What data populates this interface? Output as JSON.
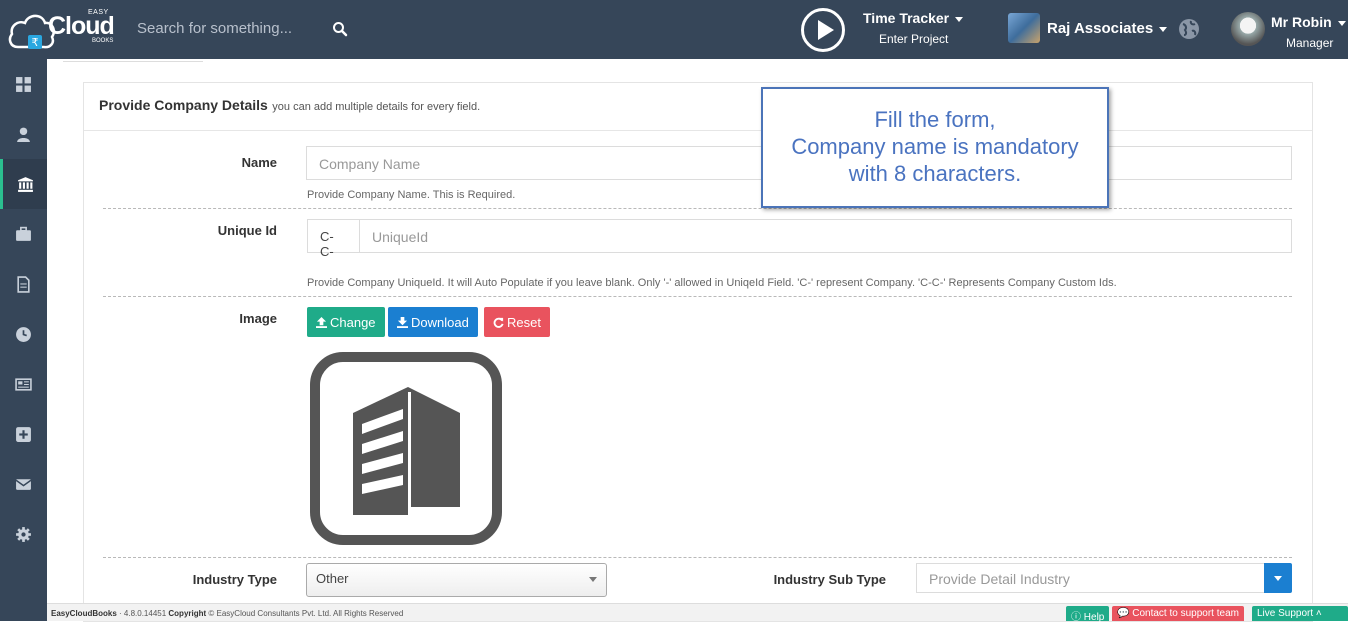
{
  "brand": {
    "easy": "EASY",
    "cloud": "Cloud",
    "books": "BOOKS"
  },
  "search": {
    "placeholder": "Search for something..."
  },
  "time_tracker": {
    "title": "Time Tracker",
    "subtitle": "Enter Project"
  },
  "organization": {
    "name": "Raj Associates"
  },
  "user": {
    "name": "Mr Robin",
    "role": "Manager"
  },
  "sidebar": {
    "items": [
      {
        "icon": "dashboard-icon",
        "active": false
      },
      {
        "icon": "user-icon",
        "active": false
      },
      {
        "icon": "bank-icon",
        "active": true
      },
      {
        "icon": "briefcase-icon",
        "active": false
      },
      {
        "icon": "document-icon",
        "active": false
      },
      {
        "icon": "clock-icon",
        "active": false
      },
      {
        "icon": "newspaper-icon",
        "active": false
      },
      {
        "icon": "plus-square-icon",
        "active": false
      },
      {
        "icon": "envelope-icon",
        "active": false
      },
      {
        "icon": "gear-icon",
        "active": false
      }
    ]
  },
  "panel": {
    "title": "Provide Company Details",
    "subtitle": "you can add multiple details for every field."
  },
  "form": {
    "name": {
      "label": "Name",
      "placeholder": "Company Name",
      "help": "Provide Company Name. This is Required."
    },
    "unique_id": {
      "label": "Unique Id",
      "prefix": "C-C-",
      "placeholder": "UniqueId",
      "help": "Provide Company UniqueId. It will Auto Populate if you leave blank. Only '-' allowed in UniqeId Field. 'C-' represent Company. 'C-C-' Represents Company Custom Ids."
    },
    "image": {
      "label": "Image",
      "change": "Change",
      "download": "Download",
      "reset": "Reset"
    },
    "industry_type": {
      "label": "Industry Type",
      "value": "Other"
    },
    "industry_sub_type": {
      "label": "Industry Sub Type",
      "placeholder": "Provide Detail Industry"
    }
  },
  "callout": {
    "line1": "Fill the form,",
    "line2": "Company name is mandatory",
    "line3": "with 8 characters."
  },
  "footer": {
    "app": "EasyCloudBooks",
    "version": " · 4.8.0.14451 ",
    "copyright_label": "Copyright",
    "copyright_text": " © EasyCloud Consultants Pvt. Ltd. All Rights Reserved",
    "help": "Help",
    "support": "Contact to support team",
    "live": "Live Support"
  },
  "colors": {
    "topbar": "#364659",
    "accent_green": "#1fab89",
    "accent_blue": "#1b7fd1",
    "accent_red": "#e9535e",
    "callout_text": "#4a73c0"
  }
}
